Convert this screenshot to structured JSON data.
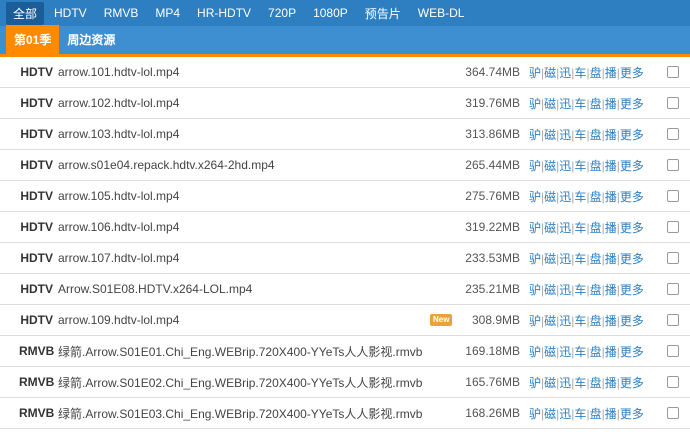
{
  "format_tabs": [
    "全部",
    "HDTV",
    "RMVB",
    "MP4",
    "HR-HDTV",
    "720P",
    "1080P",
    "预告片",
    "WEB-DL"
  ],
  "season_tabs": [
    "第01季",
    "周边资源"
  ],
  "link_labels": [
    "驴",
    "磁",
    "迅",
    "车",
    "盘",
    "播",
    "更多"
  ],
  "rows": [
    {
      "format": "HDTV",
      "name": "arrow.101.hdtv-lol.mp4",
      "size": "364.74MB",
      "badge": ""
    },
    {
      "format": "HDTV",
      "name": "arrow.102.hdtv-lol.mp4",
      "size": "319.76MB",
      "badge": ""
    },
    {
      "format": "HDTV",
      "name": "arrow.103.hdtv-lol.mp4",
      "size": "313.86MB",
      "badge": ""
    },
    {
      "format": "HDTV",
      "name": "arrow.s01e04.repack.hdtv.x264-2hd.mp4",
      "size": "265.44MB",
      "badge": ""
    },
    {
      "format": "HDTV",
      "name": "arrow.105.hdtv-lol.mp4",
      "size": "275.76MB",
      "badge": ""
    },
    {
      "format": "HDTV",
      "name": "arrow.106.hdtv-lol.mp4",
      "size": "319.22MB",
      "badge": ""
    },
    {
      "format": "HDTV",
      "name": "arrow.107.hdtv-lol.mp4",
      "size": "233.53MB",
      "badge": ""
    },
    {
      "format": "HDTV",
      "name": "Arrow.S01E08.HDTV.x264-LOL.mp4",
      "size": "235.21MB",
      "badge": ""
    },
    {
      "format": "HDTV",
      "name": "arrow.109.hdtv-lol.mp4",
      "size": "308.9MB",
      "badge": "New"
    },
    {
      "format": "RMVB",
      "name": "绿箭.Arrow.S01E01.Chi_Eng.WEBrip.720X400-YYeTs人人影视.rmvb",
      "size": "169.18MB",
      "badge": ""
    },
    {
      "format": "RMVB",
      "name": "绿箭.Arrow.S01E02.Chi_Eng.WEBrip.720X400-YYeTs人人影视.rmvb",
      "size": "165.76MB",
      "badge": ""
    },
    {
      "format": "RMVB",
      "name": "绿箭.Arrow.S01E03.Chi_Eng.WEBrip.720X400-YYeTs人人影视.rmvb",
      "size": "168.26MB",
      "badge": ""
    }
  ]
}
